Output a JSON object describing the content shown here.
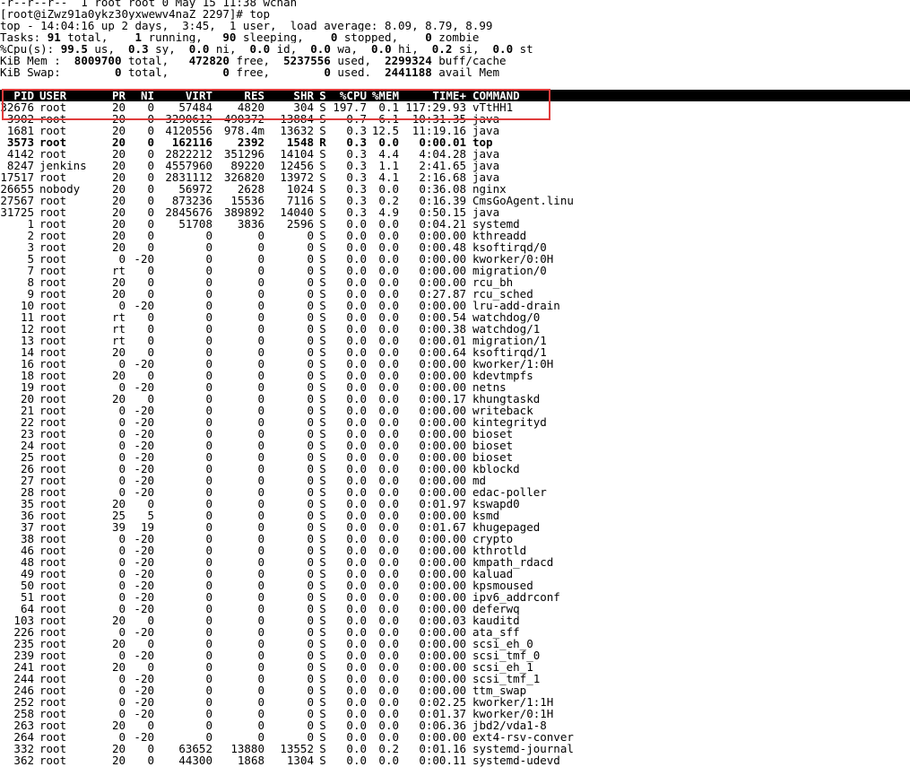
{
  "preamble": [
    "-r--r--r--  1 root root 0 May 15 11:38 wchan",
    "[root@iZwz91a0ykz30yxwewv4naZ 2297]# top"
  ],
  "summary": {
    "line1": "top - 14:04:16 up 2 days,  3:45,  1 user,  load average: 8.09, 8.79, 8.99",
    "tasks": {
      "label": "Tasks:",
      "total": "91",
      "total_label": "total,",
      "running": "1",
      "running_label": "running,",
      "sleeping": "90",
      "sleeping_label": "sleeping,",
      "stopped": "0",
      "stopped_label": "stopped,",
      "zombie": "0",
      "zombie_label": "zombie"
    },
    "cpu": {
      "label": "%Cpu(s):",
      "us": "99.5",
      "us_label": "us,",
      "sy": "0.3",
      "sy_label": "sy,",
      "ni": "0.0",
      "ni_label": "ni,",
      "id": "0.0",
      "id_label": "id,",
      "wa": "0.0",
      "wa_label": "wa,",
      "hi": "0.0",
      "hi_label": "hi,",
      "si": "0.2",
      "si_label": "si,",
      "st": "0.0",
      "st_label": "st"
    },
    "mem": {
      "label": "KiB Mem :",
      "total": "8009700",
      "total_label": "total,",
      "free": "472820",
      "free_label": "free,",
      "used": "5237556",
      "used_label": "used,",
      "buff": "2299324",
      "buff_label": "buff/cache"
    },
    "swap": {
      "label": "KiB Swap:",
      "total": "0",
      "total_label": "total,",
      "free": "0",
      "free_label": "free,",
      "used": "0",
      "used_label": "used.",
      "avail": "2441188",
      "avail_label": "avail Mem"
    }
  },
  "columns": [
    "PID",
    "USER",
    "PR",
    "NI",
    "VIRT",
    "RES",
    "SHR",
    "S",
    "%CPU",
    "%MEM",
    "TIME+",
    "COMMAND"
  ],
  "processes": [
    {
      "pid": "32676",
      "user": "root",
      "pr": "20",
      "ni": "0",
      "virt": "57484",
      "res": "4820",
      "shr": "304",
      "s": "S",
      "cpu": "197.7",
      "mem": "0.1",
      "time": "117:29.93",
      "cmd": "vTtHH1"
    },
    {
      "pid": "3902",
      "user": "root",
      "pr": "20",
      "ni": "0",
      "virt": "3290612",
      "res": "490372",
      "shr": "13884",
      "s": "S",
      "cpu": "0.7",
      "mem": "6.1",
      "time": "10:31.35",
      "cmd": "java"
    },
    {
      "pid": "1681",
      "user": "root",
      "pr": "20",
      "ni": "0",
      "virt": "4120556",
      "res": "978.4m",
      "shr": "13632",
      "s": "S",
      "cpu": "0.3",
      "mem": "12.5",
      "time": "11:19.16",
      "cmd": "java"
    },
    {
      "pid": "3573",
      "user": "root",
      "pr": "20",
      "ni": "0",
      "virt": "162116",
      "res": "2392",
      "shr": "1548",
      "s": "R",
      "cpu": "0.3",
      "mem": "0.0",
      "time": "0:00.01",
      "cmd": "top",
      "bold": true
    },
    {
      "pid": "4142",
      "user": "root",
      "pr": "20",
      "ni": "0",
      "virt": "2822212",
      "res": "351296",
      "shr": "14104",
      "s": "S",
      "cpu": "0.3",
      "mem": "4.4",
      "time": "4:04.28",
      "cmd": "java"
    },
    {
      "pid": "8247",
      "user": "jenkins",
      "pr": "20",
      "ni": "0",
      "virt": "4557960",
      "res": "89220",
      "shr": "12456",
      "s": "S",
      "cpu": "0.3",
      "mem": "1.1",
      "time": "2:41.65",
      "cmd": "java"
    },
    {
      "pid": "17517",
      "user": "root",
      "pr": "20",
      "ni": "0",
      "virt": "2831112",
      "res": "326820",
      "shr": "13972",
      "s": "S",
      "cpu": "0.3",
      "mem": "4.1",
      "time": "2:16.68",
      "cmd": "java"
    },
    {
      "pid": "26655",
      "user": "nobody",
      "pr": "20",
      "ni": "0",
      "virt": "56972",
      "res": "2628",
      "shr": "1024",
      "s": "S",
      "cpu": "0.3",
      "mem": "0.0",
      "time": "0:36.08",
      "cmd": "nginx"
    },
    {
      "pid": "27567",
      "user": "root",
      "pr": "20",
      "ni": "0",
      "virt": "873236",
      "res": "15536",
      "shr": "7116",
      "s": "S",
      "cpu": "0.3",
      "mem": "0.2",
      "time": "0:16.39",
      "cmd": "CmsGoAgent.linu"
    },
    {
      "pid": "31725",
      "user": "root",
      "pr": "20",
      "ni": "0",
      "virt": "2845676",
      "res": "389892",
      "shr": "14040",
      "s": "S",
      "cpu": "0.3",
      "mem": "4.9",
      "time": "0:50.15",
      "cmd": "java"
    },
    {
      "pid": "1",
      "user": "root",
      "pr": "20",
      "ni": "0",
      "virt": "51708",
      "res": "3836",
      "shr": "2596",
      "s": "S",
      "cpu": "0.0",
      "mem": "0.0",
      "time": "0:04.21",
      "cmd": "systemd"
    },
    {
      "pid": "2",
      "user": "root",
      "pr": "20",
      "ni": "0",
      "virt": "0",
      "res": "0",
      "shr": "0",
      "s": "S",
      "cpu": "0.0",
      "mem": "0.0",
      "time": "0:00.00",
      "cmd": "kthreadd"
    },
    {
      "pid": "3",
      "user": "root",
      "pr": "20",
      "ni": "0",
      "virt": "0",
      "res": "0",
      "shr": "0",
      "s": "S",
      "cpu": "0.0",
      "mem": "0.0",
      "time": "0:00.48",
      "cmd": "ksoftirqd/0"
    },
    {
      "pid": "5",
      "user": "root",
      "pr": "0",
      "ni": "-20",
      "virt": "0",
      "res": "0",
      "shr": "0",
      "s": "S",
      "cpu": "0.0",
      "mem": "0.0",
      "time": "0:00.00",
      "cmd": "kworker/0:0H"
    },
    {
      "pid": "7",
      "user": "root",
      "pr": "rt",
      "ni": "0",
      "virt": "0",
      "res": "0",
      "shr": "0",
      "s": "S",
      "cpu": "0.0",
      "mem": "0.0",
      "time": "0:00.00",
      "cmd": "migration/0"
    },
    {
      "pid": "8",
      "user": "root",
      "pr": "20",
      "ni": "0",
      "virt": "0",
      "res": "0",
      "shr": "0",
      "s": "S",
      "cpu": "0.0",
      "mem": "0.0",
      "time": "0:00.00",
      "cmd": "rcu_bh"
    },
    {
      "pid": "9",
      "user": "root",
      "pr": "20",
      "ni": "0",
      "virt": "0",
      "res": "0",
      "shr": "0",
      "s": "S",
      "cpu": "0.0",
      "mem": "0.0",
      "time": "0:27.87",
      "cmd": "rcu_sched"
    },
    {
      "pid": "10",
      "user": "root",
      "pr": "0",
      "ni": "-20",
      "virt": "0",
      "res": "0",
      "shr": "0",
      "s": "S",
      "cpu": "0.0",
      "mem": "0.0",
      "time": "0:00.00",
      "cmd": "lru-add-drain"
    },
    {
      "pid": "11",
      "user": "root",
      "pr": "rt",
      "ni": "0",
      "virt": "0",
      "res": "0",
      "shr": "0",
      "s": "S",
      "cpu": "0.0",
      "mem": "0.0",
      "time": "0:00.54",
      "cmd": "watchdog/0"
    },
    {
      "pid": "12",
      "user": "root",
      "pr": "rt",
      "ni": "0",
      "virt": "0",
      "res": "0",
      "shr": "0",
      "s": "S",
      "cpu": "0.0",
      "mem": "0.0",
      "time": "0:00.38",
      "cmd": "watchdog/1"
    },
    {
      "pid": "13",
      "user": "root",
      "pr": "rt",
      "ni": "0",
      "virt": "0",
      "res": "0",
      "shr": "0",
      "s": "S",
      "cpu": "0.0",
      "mem": "0.0",
      "time": "0:00.01",
      "cmd": "migration/1"
    },
    {
      "pid": "14",
      "user": "root",
      "pr": "20",
      "ni": "0",
      "virt": "0",
      "res": "0",
      "shr": "0",
      "s": "S",
      "cpu": "0.0",
      "mem": "0.0",
      "time": "0:00.64",
      "cmd": "ksoftirqd/1"
    },
    {
      "pid": "16",
      "user": "root",
      "pr": "0",
      "ni": "-20",
      "virt": "0",
      "res": "0",
      "shr": "0",
      "s": "S",
      "cpu": "0.0",
      "mem": "0.0",
      "time": "0:00.00",
      "cmd": "kworker/1:0H"
    },
    {
      "pid": "18",
      "user": "root",
      "pr": "20",
      "ni": "0",
      "virt": "0",
      "res": "0",
      "shr": "0",
      "s": "S",
      "cpu": "0.0",
      "mem": "0.0",
      "time": "0:00.00",
      "cmd": "kdevtmpfs"
    },
    {
      "pid": "19",
      "user": "root",
      "pr": "0",
      "ni": "-20",
      "virt": "0",
      "res": "0",
      "shr": "0",
      "s": "S",
      "cpu": "0.0",
      "mem": "0.0",
      "time": "0:00.00",
      "cmd": "netns"
    },
    {
      "pid": "20",
      "user": "root",
      "pr": "20",
      "ni": "0",
      "virt": "0",
      "res": "0",
      "shr": "0",
      "s": "S",
      "cpu": "0.0",
      "mem": "0.0",
      "time": "0:00.17",
      "cmd": "khungtaskd"
    },
    {
      "pid": "21",
      "user": "root",
      "pr": "0",
      "ni": "-20",
      "virt": "0",
      "res": "0",
      "shr": "0",
      "s": "S",
      "cpu": "0.0",
      "mem": "0.0",
      "time": "0:00.00",
      "cmd": "writeback"
    },
    {
      "pid": "22",
      "user": "root",
      "pr": "0",
      "ni": "-20",
      "virt": "0",
      "res": "0",
      "shr": "0",
      "s": "S",
      "cpu": "0.0",
      "mem": "0.0",
      "time": "0:00.00",
      "cmd": "kintegrityd"
    },
    {
      "pid": "23",
      "user": "root",
      "pr": "0",
      "ni": "-20",
      "virt": "0",
      "res": "0",
      "shr": "0",
      "s": "S",
      "cpu": "0.0",
      "mem": "0.0",
      "time": "0:00.00",
      "cmd": "bioset"
    },
    {
      "pid": "24",
      "user": "root",
      "pr": "0",
      "ni": "-20",
      "virt": "0",
      "res": "0",
      "shr": "0",
      "s": "S",
      "cpu": "0.0",
      "mem": "0.0",
      "time": "0:00.00",
      "cmd": "bioset"
    },
    {
      "pid": "25",
      "user": "root",
      "pr": "0",
      "ni": "-20",
      "virt": "0",
      "res": "0",
      "shr": "0",
      "s": "S",
      "cpu": "0.0",
      "mem": "0.0",
      "time": "0:00.00",
      "cmd": "bioset"
    },
    {
      "pid": "26",
      "user": "root",
      "pr": "0",
      "ni": "-20",
      "virt": "0",
      "res": "0",
      "shr": "0",
      "s": "S",
      "cpu": "0.0",
      "mem": "0.0",
      "time": "0:00.00",
      "cmd": "kblockd"
    },
    {
      "pid": "27",
      "user": "root",
      "pr": "0",
      "ni": "-20",
      "virt": "0",
      "res": "0",
      "shr": "0",
      "s": "S",
      "cpu": "0.0",
      "mem": "0.0",
      "time": "0:00.00",
      "cmd": "md"
    },
    {
      "pid": "28",
      "user": "root",
      "pr": "0",
      "ni": "-20",
      "virt": "0",
      "res": "0",
      "shr": "0",
      "s": "S",
      "cpu": "0.0",
      "mem": "0.0",
      "time": "0:00.00",
      "cmd": "edac-poller"
    },
    {
      "pid": "35",
      "user": "root",
      "pr": "20",
      "ni": "0",
      "virt": "0",
      "res": "0",
      "shr": "0",
      "s": "S",
      "cpu": "0.0",
      "mem": "0.0",
      "time": "0:01.97",
      "cmd": "kswapd0"
    },
    {
      "pid": "36",
      "user": "root",
      "pr": "25",
      "ni": "5",
      "virt": "0",
      "res": "0",
      "shr": "0",
      "s": "S",
      "cpu": "0.0",
      "mem": "0.0",
      "time": "0:00.00",
      "cmd": "ksmd"
    },
    {
      "pid": "37",
      "user": "root",
      "pr": "39",
      "ni": "19",
      "virt": "0",
      "res": "0",
      "shr": "0",
      "s": "S",
      "cpu": "0.0",
      "mem": "0.0",
      "time": "0:01.67",
      "cmd": "khugepaged"
    },
    {
      "pid": "38",
      "user": "root",
      "pr": "0",
      "ni": "-20",
      "virt": "0",
      "res": "0",
      "shr": "0",
      "s": "S",
      "cpu": "0.0",
      "mem": "0.0",
      "time": "0:00.00",
      "cmd": "crypto"
    },
    {
      "pid": "46",
      "user": "root",
      "pr": "0",
      "ni": "-20",
      "virt": "0",
      "res": "0",
      "shr": "0",
      "s": "S",
      "cpu": "0.0",
      "mem": "0.0",
      "time": "0:00.00",
      "cmd": "kthrotld"
    },
    {
      "pid": "48",
      "user": "root",
      "pr": "0",
      "ni": "-20",
      "virt": "0",
      "res": "0",
      "shr": "0",
      "s": "S",
      "cpu": "0.0",
      "mem": "0.0",
      "time": "0:00.00",
      "cmd": "kmpath_rdacd"
    },
    {
      "pid": "49",
      "user": "root",
      "pr": "0",
      "ni": "-20",
      "virt": "0",
      "res": "0",
      "shr": "0",
      "s": "S",
      "cpu": "0.0",
      "mem": "0.0",
      "time": "0:00.00",
      "cmd": "kaluad"
    },
    {
      "pid": "50",
      "user": "root",
      "pr": "0",
      "ni": "-20",
      "virt": "0",
      "res": "0",
      "shr": "0",
      "s": "S",
      "cpu": "0.0",
      "mem": "0.0",
      "time": "0:00.00",
      "cmd": "kpsmoused"
    },
    {
      "pid": "51",
      "user": "root",
      "pr": "0",
      "ni": "-20",
      "virt": "0",
      "res": "0",
      "shr": "0",
      "s": "S",
      "cpu": "0.0",
      "mem": "0.0",
      "time": "0:00.00",
      "cmd": "ipv6_addrconf"
    },
    {
      "pid": "64",
      "user": "root",
      "pr": "0",
      "ni": "-20",
      "virt": "0",
      "res": "0",
      "shr": "0",
      "s": "S",
      "cpu": "0.0",
      "mem": "0.0",
      "time": "0:00.00",
      "cmd": "deferwq"
    },
    {
      "pid": "103",
      "user": "root",
      "pr": "20",
      "ni": "0",
      "virt": "0",
      "res": "0",
      "shr": "0",
      "s": "S",
      "cpu": "0.0",
      "mem": "0.0",
      "time": "0:00.03",
      "cmd": "kauditd"
    },
    {
      "pid": "226",
      "user": "root",
      "pr": "0",
      "ni": "-20",
      "virt": "0",
      "res": "0",
      "shr": "0",
      "s": "S",
      "cpu": "0.0",
      "mem": "0.0",
      "time": "0:00.00",
      "cmd": "ata_sff"
    },
    {
      "pid": "235",
      "user": "root",
      "pr": "20",
      "ni": "0",
      "virt": "0",
      "res": "0",
      "shr": "0",
      "s": "S",
      "cpu": "0.0",
      "mem": "0.0",
      "time": "0:00.00",
      "cmd": "scsi_eh_0"
    },
    {
      "pid": "239",
      "user": "root",
      "pr": "0",
      "ni": "-20",
      "virt": "0",
      "res": "0",
      "shr": "0",
      "s": "S",
      "cpu": "0.0",
      "mem": "0.0",
      "time": "0:00.00",
      "cmd": "scsi_tmf_0"
    },
    {
      "pid": "241",
      "user": "root",
      "pr": "20",
      "ni": "0",
      "virt": "0",
      "res": "0",
      "shr": "0",
      "s": "S",
      "cpu": "0.0",
      "mem": "0.0",
      "time": "0:00.00",
      "cmd": "scsi_eh_1"
    },
    {
      "pid": "244",
      "user": "root",
      "pr": "0",
      "ni": "-20",
      "virt": "0",
      "res": "0",
      "shr": "0",
      "s": "S",
      "cpu": "0.0",
      "mem": "0.0",
      "time": "0:00.00",
      "cmd": "scsi_tmf_1"
    },
    {
      "pid": "246",
      "user": "root",
      "pr": "0",
      "ni": "-20",
      "virt": "0",
      "res": "0",
      "shr": "0",
      "s": "S",
      "cpu": "0.0",
      "mem": "0.0",
      "time": "0:00.00",
      "cmd": "ttm_swap"
    },
    {
      "pid": "252",
      "user": "root",
      "pr": "0",
      "ni": "-20",
      "virt": "0",
      "res": "0",
      "shr": "0",
      "s": "S",
      "cpu": "0.0",
      "mem": "0.0",
      "time": "0:02.25",
      "cmd": "kworker/1:1H"
    },
    {
      "pid": "258",
      "user": "root",
      "pr": "0",
      "ni": "-20",
      "virt": "0",
      "res": "0",
      "shr": "0",
      "s": "S",
      "cpu": "0.0",
      "mem": "0.0",
      "time": "0:01.37",
      "cmd": "kworker/0:1H"
    },
    {
      "pid": "263",
      "user": "root",
      "pr": "20",
      "ni": "0",
      "virt": "0",
      "res": "0",
      "shr": "0",
      "s": "S",
      "cpu": "0.0",
      "mem": "0.0",
      "time": "0:06.36",
      "cmd": "jbd2/vda1-8"
    },
    {
      "pid": "264",
      "user": "root",
      "pr": "0",
      "ni": "-20",
      "virt": "0",
      "res": "0",
      "shr": "0",
      "s": "S",
      "cpu": "0.0",
      "mem": "0.0",
      "time": "0:00.00",
      "cmd": "ext4-rsv-conver"
    },
    {
      "pid": "332",
      "user": "root",
      "pr": "20",
      "ni": "0",
      "virt": "63652",
      "res": "13880",
      "shr": "13552",
      "s": "S",
      "cpu": "0.0",
      "mem": "0.2",
      "time": "0:01.16",
      "cmd": "systemd-journal"
    },
    {
      "pid": "362",
      "user": "root",
      "pr": "20",
      "ni": "0",
      "virt": "44300",
      "res": "1868",
      "shr": "1304",
      "s": "S",
      "cpu": "0.0",
      "mem": "0.0",
      "time": "0:00.11",
      "cmd": "systemd-udevd"
    }
  ]
}
